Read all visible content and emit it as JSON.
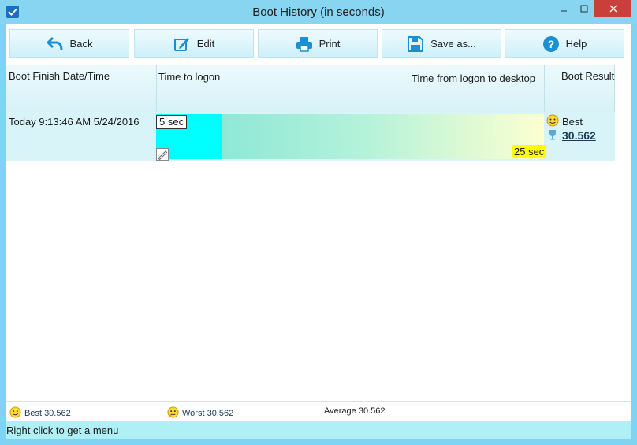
{
  "window": {
    "title": "Boot History (in seconds)"
  },
  "toolbar": {
    "back": "Back",
    "edit": "Edit",
    "print": "Print",
    "save": "Save as...",
    "help": "Help"
  },
  "columns": {
    "date": "Boot Finish Date/Time",
    "logon": "Time to logon",
    "desktop": "Time from logon to desktop",
    "result": "Boot Result"
  },
  "rows": [
    {
      "date": "Today  9:13:46 AM 5/24/2016",
      "logon_label": "5 sec",
      "desktop_label": "25 sec",
      "result_text": "Best",
      "result_value": "30.562"
    }
  ],
  "summary": {
    "best": "Best 30.562",
    "worst": "Worst 30.562",
    "average": "Average 30.562"
  },
  "status": {
    "text": "Right click to get a menu"
  },
  "colors": {
    "titlebar": "#88d5f2",
    "accent": "#7fd3f3",
    "logon_bar": "#00ffff",
    "close": "#c9403a",
    "highlight": "#ffff00"
  }
}
